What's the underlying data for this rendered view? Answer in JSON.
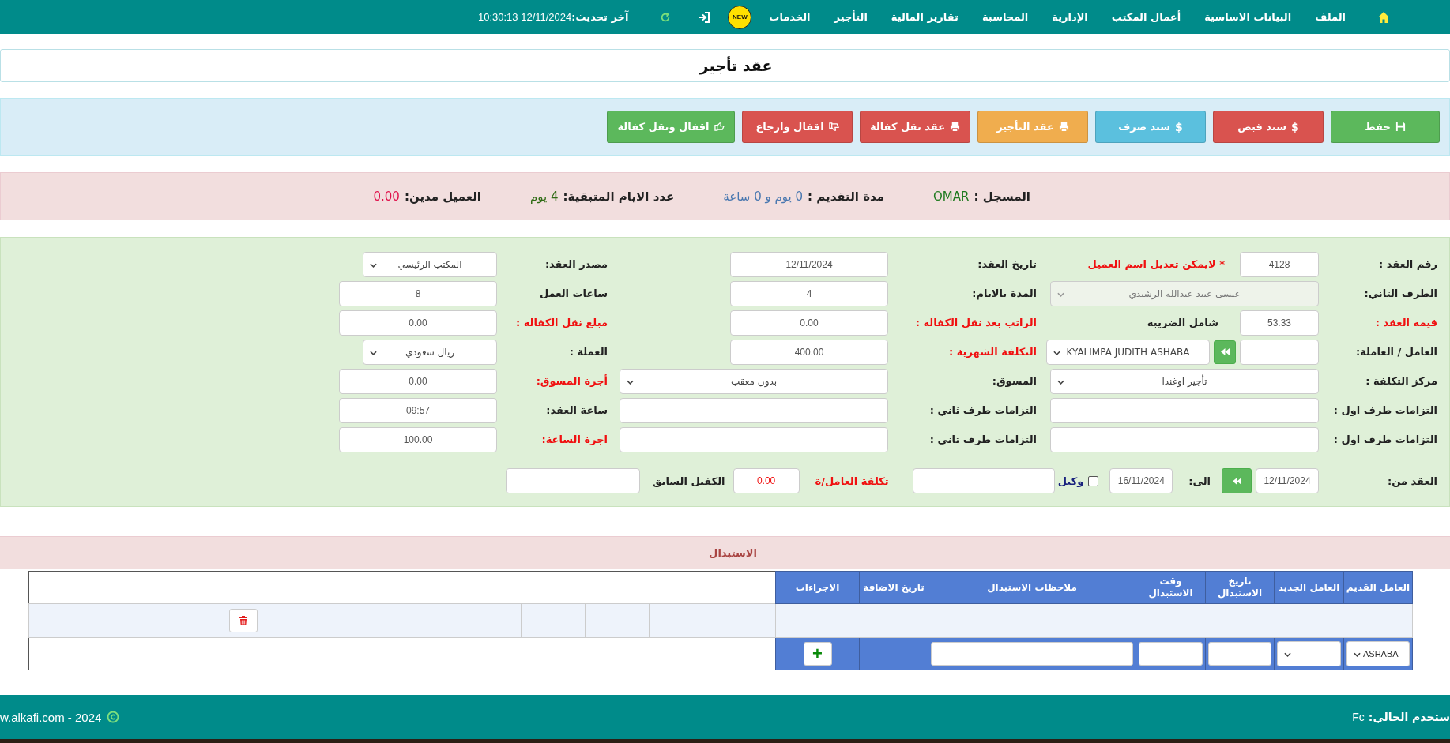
{
  "nav": {
    "items": [
      "الملف",
      "البيانات الاساسية",
      "أعمال المكتب",
      "الإدارية",
      "المحاسبة",
      "تقارير المالية",
      "التأجير",
      "الخدمات"
    ],
    "badge": "NEW",
    "update_label": "آخر تحديث:",
    "update_time": "12/11/2024 10:30:13"
  },
  "title": "عقد تأجير",
  "actions": [
    {
      "label": "حفظ"
    },
    {
      "label": "سند قبض",
      "glyph": "$"
    },
    {
      "label": "سند صرف",
      "glyph": "$"
    },
    {
      "label": "عقد التأجير"
    },
    {
      "label": "عقد نقل كفالة"
    },
    {
      "label": "اقفال وارجاع"
    },
    {
      "label": "اقفال ونقل كفالة"
    }
  ],
  "info": [
    {
      "label": "المسجل :",
      "value": "OMAR",
      "color": "#1f7a1f"
    },
    {
      "label": "مدة التقديم :",
      "value": "0 يوم و 0 ساعة",
      "color": "#4a78b0"
    },
    {
      "label": "عدد الايام المتبقية:",
      "value": "4 يوم",
      "color": "#2e6b14"
    },
    {
      "label": "العميل مدين:",
      "value": "0.00",
      "color": "#e0104a"
    }
  ],
  "form": {
    "rows": [
      {
        "cells": [
          {
            "label": {
              "text": "رقم العقد :",
              "highlighted": false
            },
            "controls": [
              {
                "kind": "input",
                "value": "4128"
              },
              {
                "kind": "note",
                "text": "* لايمكن تعديل اسم العميل"
              }
            ]
          },
          {
            "label": {
              "text": "تاريخ العقد:",
              "highlighted": false
            },
            "controls": [
              {
                "kind": "input",
                "value": "12/11/2024"
              }
            ]
          },
          {
            "label": {
              "text": "مصدر العقد:",
              "highlighted": false
            },
            "controls": [
              {
                "kind": "select",
                "value": "المكتب الرئيسي",
                "disabled": false
              }
            ]
          }
        ]
      },
      {
        "cells": [
          {
            "label": {
              "text": "الطرف الثاني:",
              "highlighted": false
            },
            "controls": [
              {
                "kind": "select",
                "value": "عيسى عبيد عبدالله الرشيدي",
                "disabled": true
              }
            ]
          },
          {
            "label": {
              "text": "المدة بالايام:",
              "highlighted": false
            },
            "controls": [
              {
                "kind": "input",
                "value": "4"
              }
            ]
          },
          {
            "label": {
              "text": "ساعات العمل",
              "highlighted": false
            },
            "controls": [
              {
                "kind": "input",
                "value": "8"
              }
            ]
          }
        ]
      },
      {
        "cells": [
          {
            "label": {
              "text": "قيمة العقد :",
              "highlighted": true
            },
            "controls": [
              {
                "kind": "input",
                "value": "53.33"
              },
              {
                "kind": "label",
                "text": "شامل الضريبة"
              }
            ]
          },
          {
            "label": {
              "text": "الراتب بعد نقل الكفالة :",
              "highlighted": true
            },
            "controls": [
              {
                "kind": "input",
                "value": "0.00"
              }
            ]
          },
          {
            "label": {
              "text": "مبلغ نقل الكفالة :",
              "highlighted": true
            },
            "controls": [
              {
                "kind": "input",
                "value": "0.00"
              }
            ]
          }
        ]
      },
      {
        "cells": [
          {
            "label": {
              "text": "العامل / العاملة:",
              "highlighted": false
            },
            "controls": [
              {
                "kind": "input"
              },
              {
                "kind": "button"
              },
              {
                "kind": "select",
                "value": "KYALIMPA JUDITH ASHABA",
                "disabled": false
              }
            ]
          },
          {
            "label": {
              "text": "التكلفة الشهرية :",
              "highlighted": true
            },
            "controls": [
              {
                "kind": "input",
                "value": "400.00"
              }
            ]
          },
          {
            "label": {
              "text": "العملة :",
              "highlighted": false
            },
            "controls": [
              {
                "kind": "select",
                "value": "ريال سعودي",
                "disabled": false
              }
            ]
          }
        ]
      },
      {
        "cells": [
          {
            "label": {
              "text": "مركز التكلفة :",
              "highlighted": false
            },
            "controls": [
              {
                "kind": "select",
                "value": "تأجير اوغندا",
                "disabled": false
              }
            ]
          },
          {
            "label": {
              "text": "المسوق:",
              "highlighted": false
            },
            "controls": [
              {
                "kind": "select",
                "value": "بدون معقب",
                "disabled": false
              }
            ]
          },
          {
            "label": {
              "text": "أجرة المسوق:",
              "highlighted": true
            },
            "controls": [
              {
                "kind": "input",
                "value": "0.00"
              }
            ]
          }
        ]
      },
      {
        "cells": [
          {
            "label": {
              "text": "التزامات طرف اول :",
              "highlighted": false
            },
            "controls": [
              {
                "kind": "input"
              }
            ]
          },
          {
            "label": {
              "text": "التزامات طرف ثاني :",
              "highlighted": false
            },
            "controls": [
              {
                "kind": "input"
              }
            ]
          },
          {
            "label": {
              "text": "ساعة العقد:",
              "highlighted": false
            },
            "controls": [
              {
                "kind": "input",
                "value": "09:57"
              }
            ]
          }
        ]
      },
      {
        "cells": [
          {
            "label": {
              "text": "التزامات طرف اول :",
              "highlighted": false
            },
            "controls": [
              {
                "kind": "input"
              }
            ]
          },
          {
            "label": {
              "text": "التزامات طرف ثاني :",
              "highlighted": false
            },
            "controls": [
              {
                "kind": "input"
              }
            ]
          },
          {
            "label": {
              "text": "اجرة الساعة:",
              "highlighted": true
            },
            "controls": [
              {
                "kind": "input",
                "value": "100.00"
              }
            ]
          }
        ]
      }
    ],
    "period_row": [
      {
        "kind": "label",
        "text": "العقد من:",
        "highlighted": false
      },
      {
        "kind": "input",
        "value": "12/11/2024",
        "highlighted": false
      },
      {
        "kind": "button"
      },
      {
        "kind": "label",
        "text": "الى:",
        "highlighted": false
      },
      {
        "kind": "input",
        "value": "16/11/2024",
        "highlighted": false
      },
      {
        "kind": "checkbox",
        "label": "وكيل",
        "checked": false
      },
      {
        "kind": "input"
      },
      {
        "kind": "label",
        "text": "تكلفة العامل/ة",
        "highlighted": true
      },
      {
        "kind": "input",
        "value": "0.00",
        "highlighted": true
      },
      {
        "kind": "label",
        "text": "الكفيل السابق",
        "highlighted": false
      },
      {
        "kind": "input"
      }
    ]
  },
  "replacement": {
    "title": "الاستبدال",
    "columns": [
      "العامل القديم",
      "العامل الجديد",
      "تاريخ الاستبدال",
      "وقت الاستبدال",
      "ملاحظات الاستبدال",
      "تاريخ الاضافة",
      "الاجراءات"
    ],
    "entry": [
      {
        "kind": "select",
        "value": "ASHABA"
      },
      {
        "kind": "select"
      },
      {
        "kind": "input"
      },
      {
        "kind": "input"
      },
      {
        "kind": "input"
      },
      {
        "kind": "blank"
      },
      {
        "kind": "add",
        "text": "+"
      }
    ]
  },
  "footer": {
    "user_label": "ستخدم الحالي:",
    "user": "Fc",
    "copyright": "w.alkafi.com - 2024"
  }
}
